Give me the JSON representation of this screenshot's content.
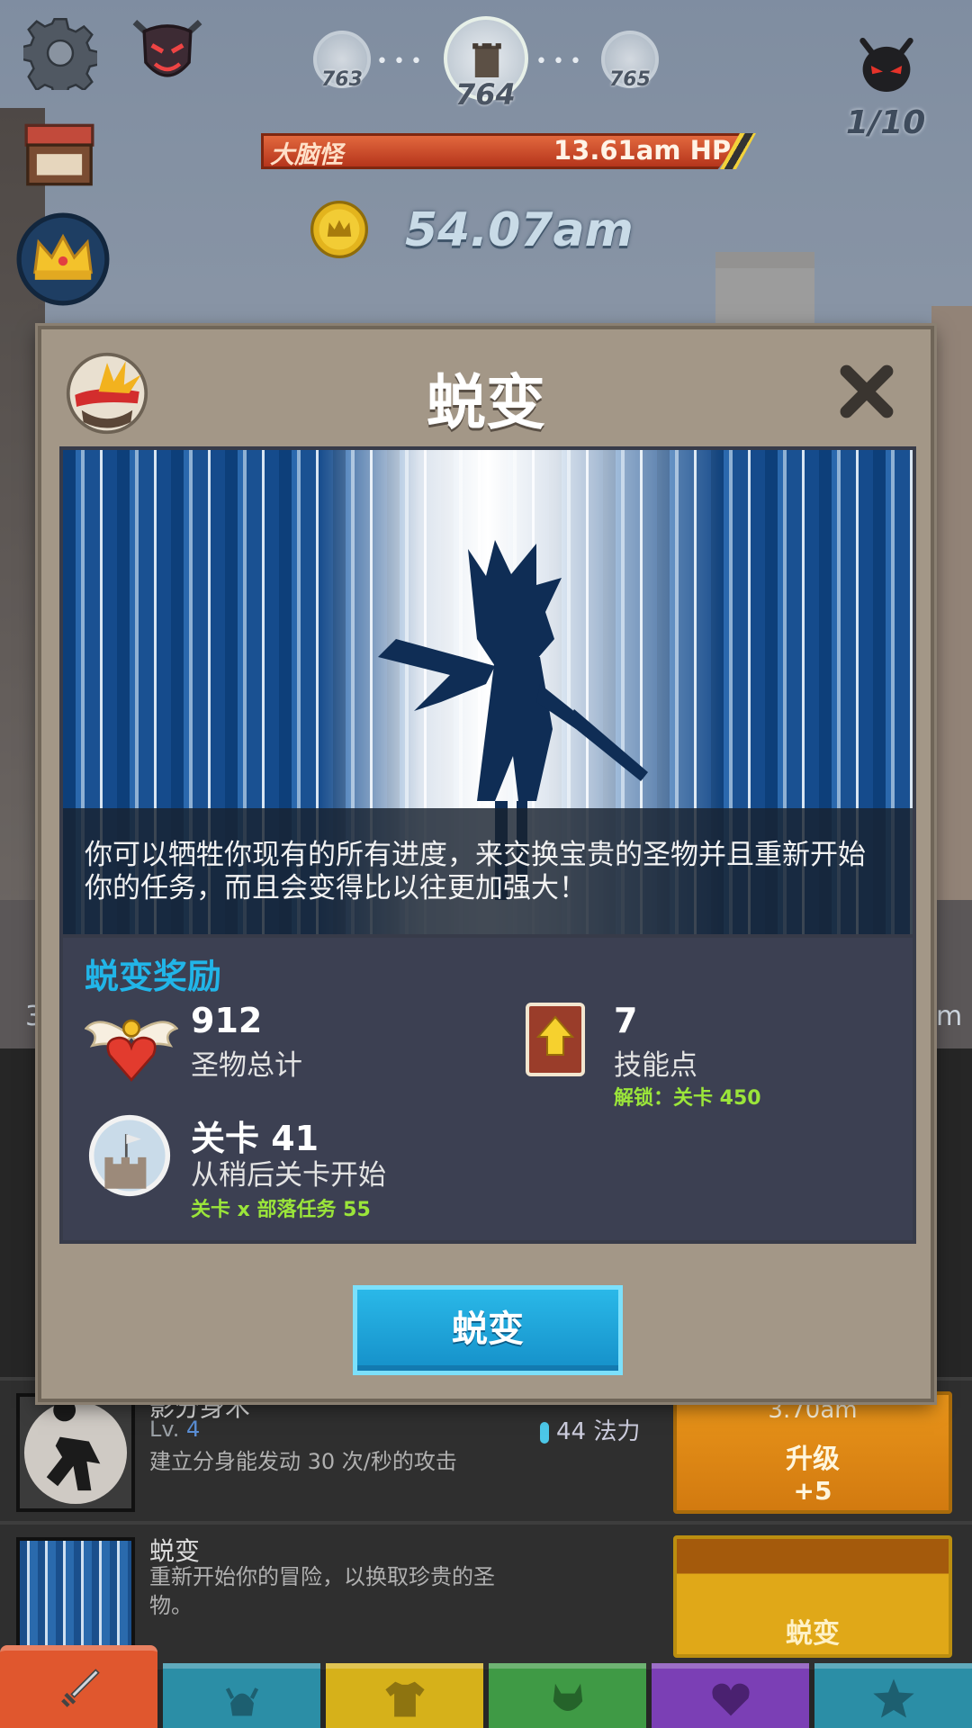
{
  "hud": {
    "stages": [
      "763",
      "764",
      "765"
    ],
    "boss_count": "1/10",
    "enemy_name": "大脑怪",
    "enemy_hp": "13.61am HP",
    "gold": "54.07am"
  },
  "modal": {
    "title": "蜕变",
    "description": "你可以牺牲你现有的所有进度，来交换宝贵的圣物并且重新开始你的任务，而且会变得比以往更加强大！",
    "rewards_title": "蜕变奖励",
    "rewards": {
      "relics_value": "912",
      "relics_label": "圣物总计",
      "skill_value": "7",
      "skill_label": "技能点",
      "skill_unlock": "解锁：关卡 450",
      "stage_value": "关卡 41",
      "stage_label": "从稍后关卡开始",
      "stage_note": "关卡 x 部落任务 55"
    },
    "button_label": "蜕变"
  },
  "under": {
    "side_left": "3",
    "side_right": "m",
    "shadow_row": {
      "title": "影分身术",
      "level_label": "Lv.",
      "level": "4",
      "desc": "建立分身能发动 30 次/秒的攻击",
      "mana": "44 法力",
      "btn_top": "3.70am",
      "btn_label": "升级",
      "btn_sub": "+5"
    },
    "prestige_row": {
      "title": "蜕变",
      "desc": "重新开始你的冒险，以换取珍贵的圣物。",
      "btn_label": "蜕变"
    }
  },
  "tabs": [
    {
      "name": "sword-icon",
      "color": "#e0572e"
    },
    {
      "name": "viking-helmet-icon",
      "color": "#2b8ea6"
    },
    {
      "name": "shirt-icon",
      "color": "#d6b11a"
    },
    {
      "name": "pet-icon",
      "color": "#3f9a45"
    },
    {
      "name": "heart-icon",
      "color": "#7b3fb5"
    },
    {
      "name": "star-icon",
      "color": "#2b8ea6"
    }
  ]
}
